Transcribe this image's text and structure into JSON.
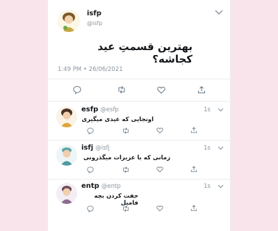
{
  "main_tweet": {
    "display_name": "isfp",
    "handle": "@isfp",
    "text": "بهترین قسمتِ عید کجاشه؟",
    "timestamp": "1:49 PM • 26/06/2021"
  },
  "replies": [
    {
      "display_name": "esfp",
      "handle": "@esfp",
      "time": "1s",
      "text": "اونجایی که عیدی میگیری"
    },
    {
      "display_name": "isfj",
      "handle": "@isfj",
      "time": "1s",
      "text": "زمانی که با عزیزات میگذرونی"
    },
    {
      "display_name": "entp",
      "handle": "@entp",
      "time": "1s",
      "text": "جفت کردن بچه فامیل"
    }
  ],
  "icons": {
    "caret": "chevron-down-icon",
    "reply": "comment-icon",
    "retweet": "retweet-icon",
    "like": "heart-icon",
    "share": "share-icon"
  },
  "colors": {
    "background": "#f9e4ec",
    "card": "#ffffff",
    "text": "#14171a",
    "muted": "#8a959e",
    "divider": "#e9edf0"
  }
}
